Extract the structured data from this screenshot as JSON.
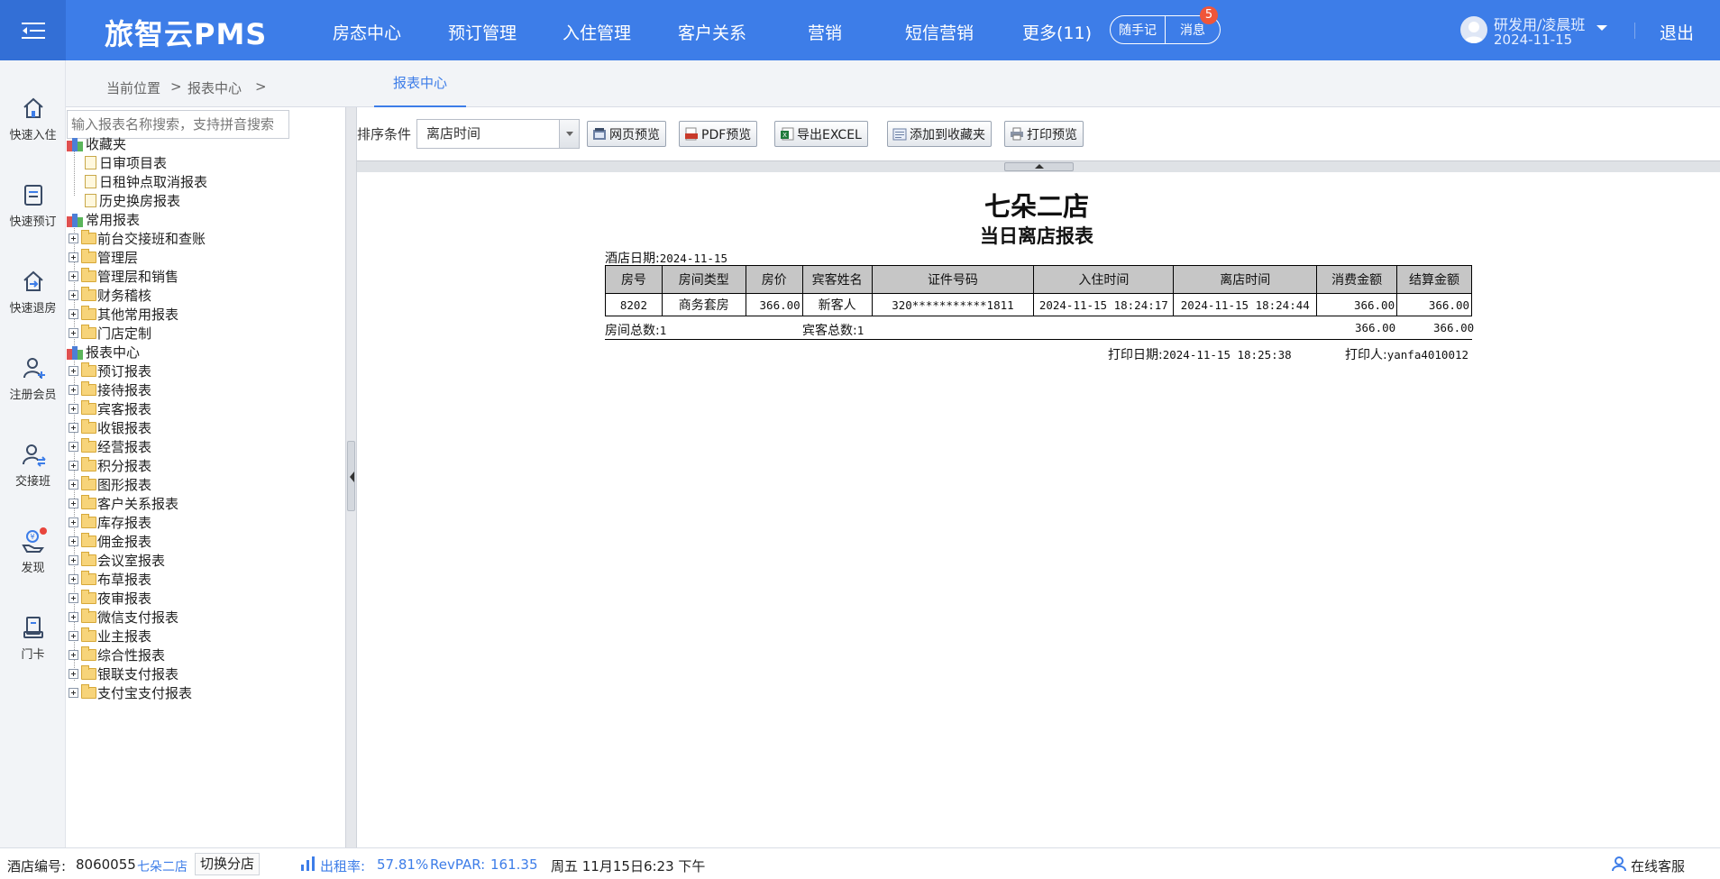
{
  "header": {
    "logo": "旅智云PMS",
    "nav": [
      "房态中心",
      "预订管理",
      "入住管理",
      "客户关系",
      "营销",
      "短信营销",
      "更多(11)"
    ],
    "note_label": "随手记",
    "message_label": "消息",
    "message_count": "5",
    "user_name": "研发用/凌晨班",
    "user_date": "2024-11-15",
    "logout_label": "退出",
    "colors": {
      "primary": "#3d7de8",
      "badge": "#f0563a"
    }
  },
  "quickbar": [
    {
      "label": "快速入住",
      "icon": "home-icon"
    },
    {
      "label": "快速预订",
      "icon": "booking-icon"
    },
    {
      "label": "快速退房",
      "icon": "checkout-icon"
    },
    {
      "label": "注册会员",
      "icon": "add-user-icon"
    },
    {
      "label": "交接班",
      "icon": "shift-handover-icon"
    },
    {
      "label": "发现",
      "icon": "discover-icon"
    },
    {
      "label": "门卡",
      "icon": "door-card-icon"
    }
  ],
  "breadcrumb": {
    "prefix": "当前位置",
    "sep1": ">",
    "section": "报表中心",
    "sep2": ">",
    "active_tab": "报表中心"
  },
  "tree": {
    "search_placeholder": "输入报表名称搜索，支持拼音搜索",
    "favorites_label": "收藏夹",
    "favorites": [
      "日审项目表",
      "日租钟点取消报表",
      "历史换房报表"
    ],
    "common_label": "常用报表",
    "common": [
      "前台交接班和查账",
      "管理层",
      "管理层和销售",
      "财务稽核",
      "其他常用报表",
      "门店定制"
    ],
    "center_label": "报表中心",
    "center": [
      "预订报表",
      "接待报表",
      "宾客报表",
      "收银报表",
      "经营报表",
      "积分报表",
      "图形报表",
      "客户关系报表",
      "库存报表",
      "佣金报表",
      "会议室报表",
      "布草报表",
      "夜审报表",
      "微信支付报表",
      "业主报表",
      "综合性报表",
      "银联支付报表",
      "支付宝支付报表"
    ]
  },
  "toolbar": {
    "sort_label": "排序条件",
    "sort_value": "离店时间",
    "buttons": [
      "网页预览",
      "PDF预览",
      "导出EXCEL",
      "添加到收藏夹",
      "打印预览"
    ]
  },
  "report": {
    "hotel_name": "七朵二店",
    "title": "当日离店报表",
    "hotel_date_label": "酒店日期:",
    "hotel_date": "2024-11-15",
    "columns": [
      "房号",
      "房间类型",
      "房价",
      "宾客姓名",
      "证件号码",
      "入住时间",
      "离店时间",
      "消费金额",
      "结算金额"
    ],
    "rows": [
      [
        "8202",
        "商务套房",
        "366.00",
        "新客人",
        "320***********1811",
        "2024-11-15 18:24:17",
        "2024-11-15 18:24:44",
        "366.00",
        "366.00"
      ]
    ],
    "room_total_label": "房间总数:",
    "room_total": "1",
    "guest_total_label": "宾客总数:",
    "guest_total": "1",
    "consume_total": "366.00",
    "settle_total": "366.00",
    "print_date_label": "打印日期:",
    "print_date": "2024-11-15 18:25:38",
    "printer_label": "打印人:",
    "printer": "yanfa4010012"
  },
  "status": {
    "hotel_code_label": "酒店编号:",
    "hotel_code": "8060055",
    "hotel_name": "七朵二店",
    "switch_label": "切换分店",
    "occupancy_label": "出租率:",
    "occupancy": "57.81%",
    "revpar_label": "RevPAR:",
    "revpar": "161.35",
    "datetime": "周五 11月15日6:23 下午",
    "support_label": "在线客服"
  }
}
